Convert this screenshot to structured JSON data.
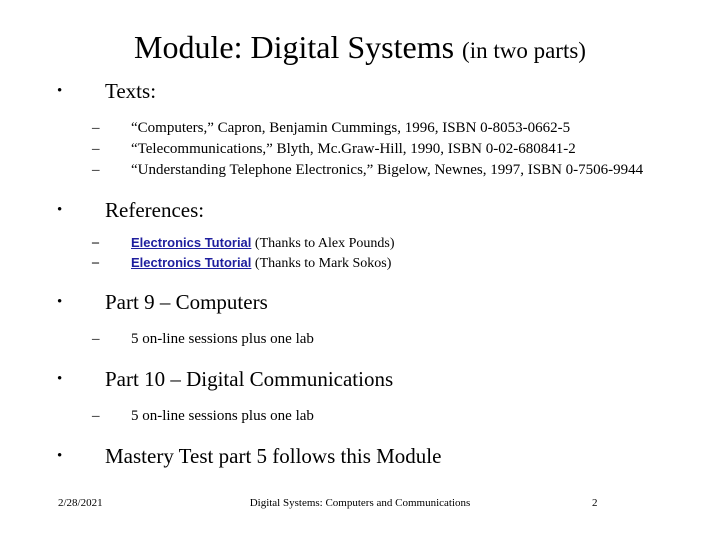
{
  "slide": {
    "title": {
      "main": "Module: Digital Systems ",
      "sub": "(in two parts)"
    },
    "sections": [
      {
        "heading": "Texts:",
        "bullet_glyph": "•",
        "items": [
          {
            "dash": "–",
            "text": "“Computers,” Capron, Benjamin Cummings, 1996, ISBN 0-8053-0662-5"
          },
          {
            "dash": "–",
            "text": "“Telecommunications,” Blyth, Mc.Graw-Hill, 1990, ISBN 0-02-680841-2"
          },
          {
            "dash": "–",
            "text": "“Understanding Telephone Electronics,” Bigelow, Newnes, 1997, ISBN 0-7506-9944"
          }
        ]
      },
      {
        "heading": "References:",
        "bullet_glyph": "•",
        "links": [
          {
            "dash": "–",
            "link_text": "Electronics Tutorial",
            "thanks": " (Thanks to Alex Pounds)"
          },
          {
            "dash": "–",
            "link_text": "Electronics Tutorial",
            "thanks": " (Thanks to Mark Sokos)"
          }
        ]
      },
      {
        "heading": "Part 9 – Computers",
        "bullet_glyph": "•",
        "items": [
          {
            "dash": "–",
            "text": "5 on-line sessions plus one lab"
          }
        ]
      },
      {
        "heading": "Part 10 – Digital Communications",
        "bullet_glyph": "•",
        "items": [
          {
            "dash": "–",
            "text": "5 on-line sessions plus one lab"
          }
        ]
      },
      {
        "heading": "Mastery Test part 5 follows this Module",
        "bullet_glyph": "•",
        "items": []
      }
    ],
    "footer": {
      "date": "2/28/2021",
      "center": "Digital Systems: Computers and Communications",
      "page": "2"
    },
    "colors": {
      "background": "#ffffff",
      "text": "#000000",
      "link": "#1f1f9e"
    }
  }
}
